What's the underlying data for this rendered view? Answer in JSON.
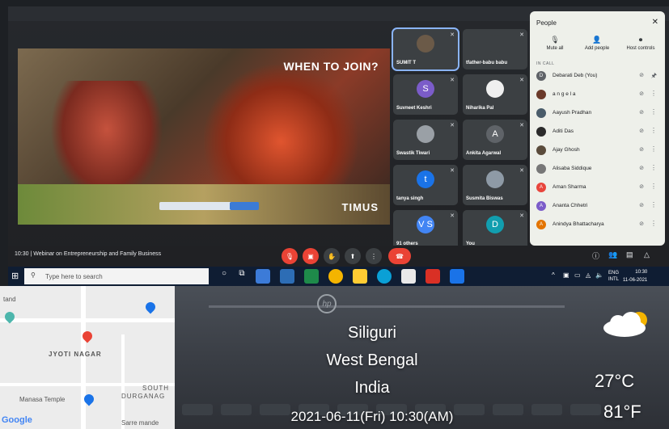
{
  "presentation": {
    "slide_title": "WHEN TO JOIN?",
    "logo_text": "TIMUS"
  },
  "tiles": [
    {
      "name": "SUMIT T",
      "initial": "",
      "color": "#6b5a48",
      "active": true
    },
    {
      "name": "tfather-babu babu",
      "initial": "",
      "color": "#3c4043",
      "active": false
    },
    {
      "name": "Suvneet Keshri",
      "initial": "S",
      "color": "#7b5cc9",
      "active": false
    },
    {
      "name": "Niharika Pal",
      "initial": "",
      "color": "#efefef",
      "active": false
    },
    {
      "name": "Swastik Tiwari",
      "initial": "",
      "color": "#9aa0a6",
      "active": false
    },
    {
      "name": "Ankita Agarwal",
      "initial": "A",
      "color": "#5f6368",
      "active": false
    },
    {
      "name": "tanya singh",
      "initial": "t",
      "color": "#1a73e8",
      "active": false
    },
    {
      "name": "Susmita Biswas",
      "initial": "",
      "color": "#8e9aa6",
      "active": false
    },
    {
      "name": "91 others",
      "initial": "V S",
      "color": "#4285f4",
      "active": false
    },
    {
      "name": "You",
      "initial": "D",
      "color": "#129eaf",
      "active": false
    }
  ],
  "people_panel": {
    "title": "People",
    "actions": [
      {
        "label": "Mute all",
        "icon": "mic-off-icon",
        "glyph": "🎙"
      },
      {
        "label": "Add people",
        "icon": "add-person-icon",
        "glyph": "👤"
      },
      {
        "label": "Host controls",
        "icon": "toggle-icon",
        "glyph": "⏺"
      }
    ],
    "in_call_label": "IN CALL",
    "participants": [
      {
        "name": "Debarati Deb (You)",
        "initial": "D",
        "color": "#5f6368",
        "pin": "🖈"
      },
      {
        "name": "a n g e l a",
        "initial": "",
        "color": "#6b3a2a",
        "pin": "⋮"
      },
      {
        "name": "Aayush Pradhan",
        "initial": "",
        "color": "#4a5c6a",
        "pin": "⋮"
      },
      {
        "name": "Aditi Das",
        "initial": "",
        "color": "#2b2b2b",
        "pin": "⋮"
      },
      {
        "name": "Ajay Ghosh",
        "initial": "",
        "color": "#5a4b3b",
        "pin": "⋮"
      },
      {
        "name": "Alisaba Siddique",
        "initial": "",
        "color": "#777777",
        "pin": "⋮"
      },
      {
        "name": "Aman Sharma",
        "initial": "A",
        "color": "#e8453c",
        "pin": "⋮"
      },
      {
        "name": "Ananta Chhetri",
        "initial": "A",
        "color": "#7b5cc9",
        "pin": "⋮"
      },
      {
        "name": "Anindya Bhattacharya",
        "initial": "A",
        "color": "#e37400",
        "pin": "⋮"
      }
    ]
  },
  "meet_bar": {
    "time": "10:30",
    "separator": "|",
    "meeting_name": "Webinar on Entrepreneurship and Family Business"
  },
  "taskbar": {
    "search_placeholder": "Type here to search",
    "lang": "ENG",
    "lang_sub": "INTL",
    "clock_time": "10:30",
    "clock_date": "11-06-2021"
  },
  "map": {
    "labels": {
      "tand": "tand",
      "jyoti_nagar": "JYOTI NAGAR",
      "south": "SOUTH",
      "durganag": "DURGANAG",
      "manasa": "Manasa Temple",
      "sarre": "Sarre mande"
    },
    "google": "Google"
  },
  "location": {
    "city": "Siliguri",
    "state": "West Bengal",
    "country": "India",
    "datetime": "2021-06-11(Fri)  10:30(AM)",
    "temp_c": "27°C",
    "temp_f": "81°F"
  }
}
